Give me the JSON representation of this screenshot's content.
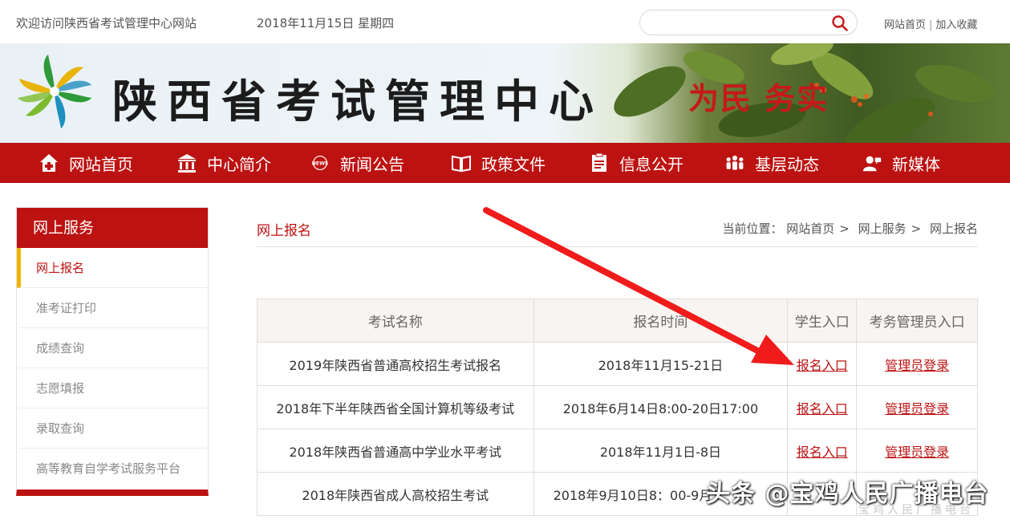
{
  "top": {
    "welcome": "欢迎访问陕西省考试管理中心网站",
    "date": "2018年11月15日   星期四",
    "search_placeholder": "",
    "link_home": "网站首页",
    "link_fav": "加入收藏"
  },
  "banner": {
    "site_name": "陕西省考试管理中心",
    "slogan": "为民  务实"
  },
  "nav": [
    {
      "label": "网站首页",
      "icon": "home-icon"
    },
    {
      "label": "中心简介",
      "icon": "building-icon"
    },
    {
      "label": "新闻公告",
      "icon": "news-icon"
    },
    {
      "label": "政策文件",
      "icon": "book-icon"
    },
    {
      "label": "信息公开",
      "icon": "document-icon"
    },
    {
      "label": "基层动态",
      "icon": "people-icon"
    },
    {
      "label": "新媒体",
      "icon": "media-icon"
    }
  ],
  "sidebar": {
    "title": "网上服务",
    "items": [
      {
        "label": "网上报名"
      },
      {
        "label": "准考证打印"
      },
      {
        "label": "成绩查询"
      },
      {
        "label": "志愿填报"
      },
      {
        "label": "录取查询"
      },
      {
        "label": "高等教育自学考试服务平台"
      }
    ]
  },
  "content": {
    "title": "网上报名",
    "breadcrumb_prefix": "当前位置：",
    "breadcrumb": [
      "网站首页",
      "网上服务",
      "网上报名"
    ],
    "table": {
      "headers": [
        "考试名称",
        "报名时间",
        "学生入口",
        "考务管理员入口"
      ],
      "rows": [
        {
          "name": "2019年陕西省普通高校招生考试报名",
          "time": "2018年11月15-21日",
          "student": "报名入口",
          "admin": "管理员登录"
        },
        {
          "name": "2018年下半年陕西省全国计算机等级考试",
          "time": "2018年6月14日8:00-20日17:00",
          "student": "报名入口",
          "admin": "管理员登录"
        },
        {
          "name": "2018年陕西省普通高中学业水平考试",
          "time": "2018年11月1日-8日",
          "student": "报名入口",
          "admin": "管理员登录"
        },
        {
          "name": "2018年陕西省成人高校招生考试",
          "time": "2018年9月10日8：00-9月1",
          "student": "",
          "admin": ""
        }
      ]
    }
  },
  "watermark": {
    "text": "头条 @宝鸡人民广播电台",
    "sub": "宝鸡人民广播电台"
  },
  "colors": {
    "brand_red": "#bd1212",
    "accent_yellow": "#f0b400"
  }
}
